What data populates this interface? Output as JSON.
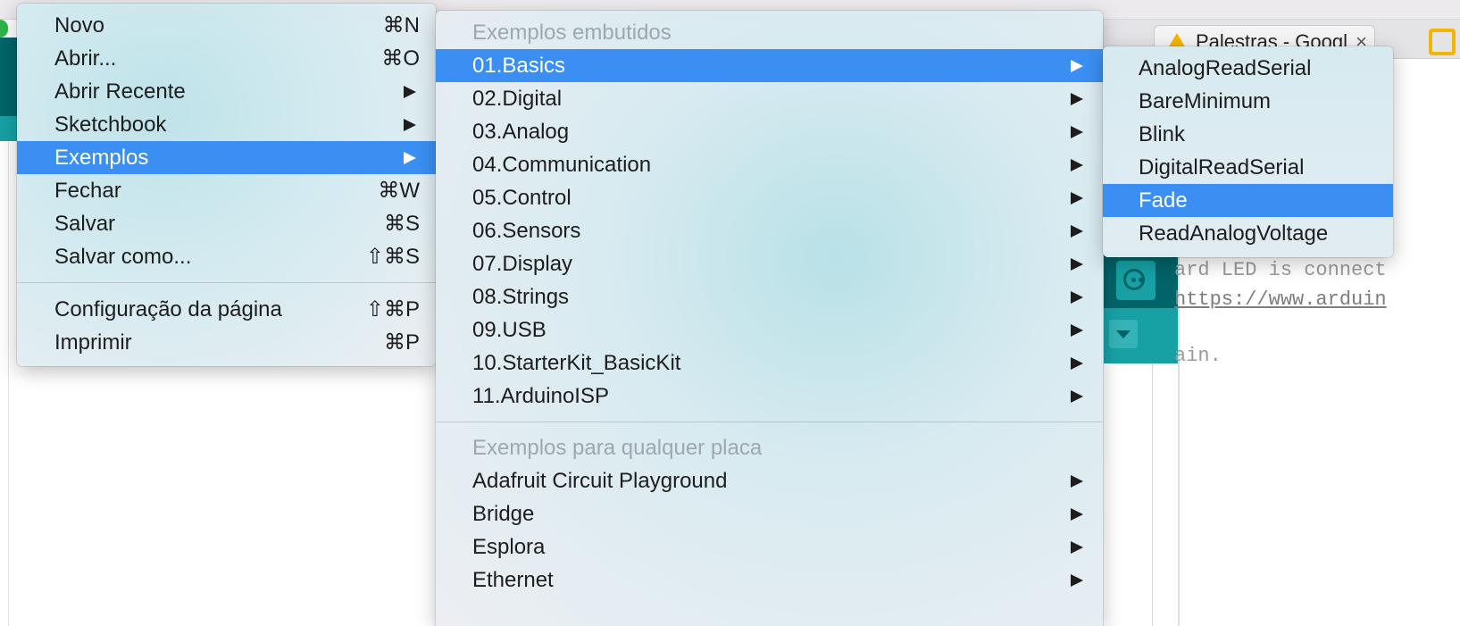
{
  "file_menu": {
    "items": [
      {
        "label": "Novo",
        "shortcut": "⌘N"
      },
      {
        "label": "Abrir...",
        "shortcut": "⌘O"
      },
      {
        "label": "Abrir Recente",
        "submenu": true
      },
      {
        "label": "Sketchbook",
        "submenu": true
      },
      {
        "label": "Exemplos",
        "submenu": true,
        "selected": true
      },
      {
        "label": "Fechar",
        "shortcut": "⌘W"
      },
      {
        "label": "Salvar",
        "shortcut": "⌘S"
      },
      {
        "label": "Salvar como...",
        "shortcut": "⇧⌘S"
      }
    ],
    "items2": [
      {
        "label": "Configuração da página",
        "shortcut": "⇧⌘P"
      },
      {
        "label": "Imprimir",
        "shortcut": "⌘P"
      }
    ]
  },
  "examples_menu": {
    "builtin_header": "Exemplos embutidos",
    "builtin": [
      {
        "label": "01.Basics",
        "selected": true
      },
      {
        "label": "02.Digital"
      },
      {
        "label": "03.Analog"
      },
      {
        "label": "04.Communication"
      },
      {
        "label": "05.Control"
      },
      {
        "label": "06.Sensors"
      },
      {
        "label": "07.Display"
      },
      {
        "label": "08.Strings"
      },
      {
        "label": "09.USB"
      },
      {
        "label": "10.StarterKit_BasicKit"
      },
      {
        "label": "11.ArduinoISP"
      }
    ],
    "any_board_header": "Exemplos para qualquer placa",
    "any_board": [
      {
        "label": "Adafruit Circuit Playground"
      },
      {
        "label": "Bridge"
      },
      {
        "label": "Esplora"
      },
      {
        "label": "Ethernet"
      }
    ]
  },
  "basics_menu": {
    "items": [
      {
        "label": "AnalogReadSerial"
      },
      {
        "label": "BareMinimum"
      },
      {
        "label": "Blink"
      },
      {
        "label": "DigitalReadSerial"
      },
      {
        "label": "Fade",
        "selected": true
      },
      {
        "label": "ReadAnalogVoltage"
      }
    ]
  },
  "background": {
    "browser_tab_title": "Palestras - Googl",
    "browser_tab_close": "×",
    "code_lines": [
      "ard LED is connect",
      "https://www.arduin",
      "ain."
    ]
  },
  "colors": {
    "selection": "#3b8ff2",
    "arduino_teal_dark": "#006468",
    "arduino_teal": "#17a1a5",
    "header_gray": "#9ea7ad"
  },
  "icons": {
    "submenu": "submenu-arrow-icon",
    "serial_monitor": "serial-monitor-icon",
    "tab_dropdown": "tab-dropdown-icon",
    "drive": "google-drive-icon"
  }
}
